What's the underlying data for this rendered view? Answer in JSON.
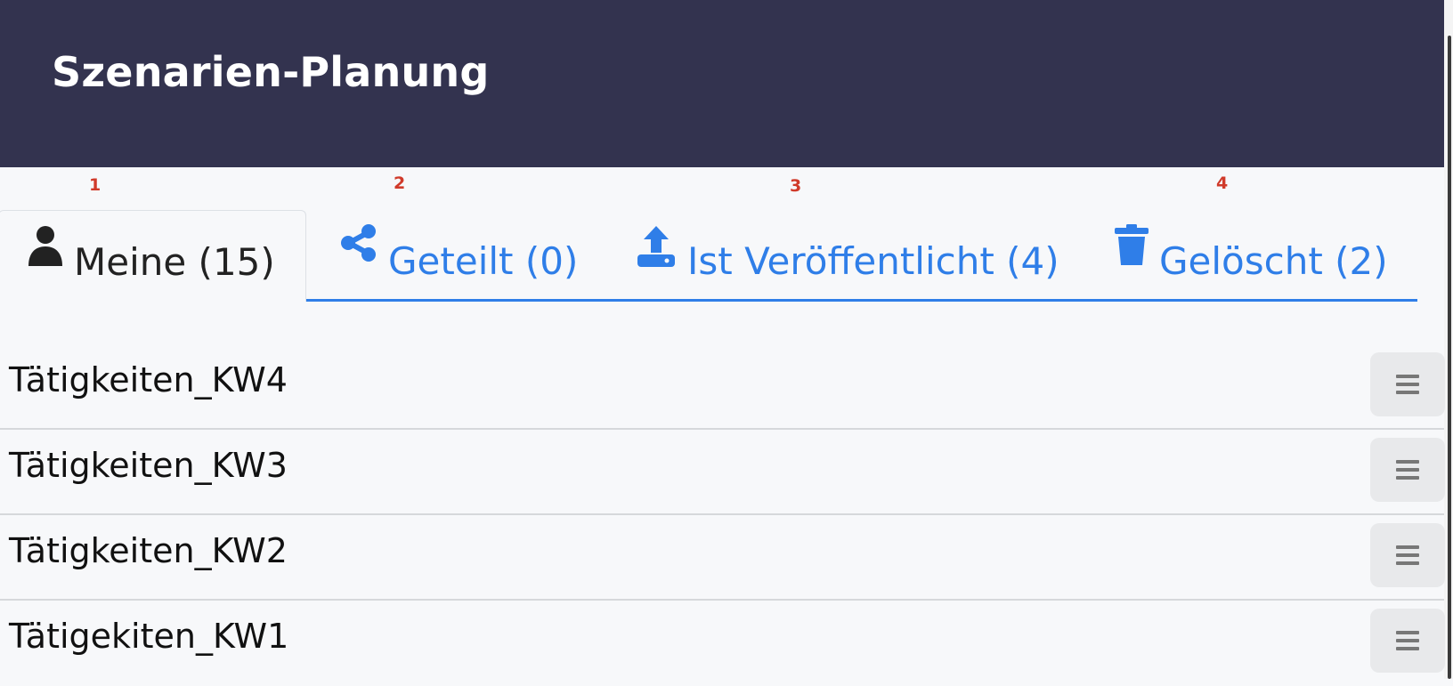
{
  "app": {
    "title": "Szenarien-Planung"
  },
  "markers": [
    "1",
    "2",
    "3",
    "4"
  ],
  "tabs": [
    {
      "label": "Meine (15)",
      "icon": "user-icon",
      "active": true
    },
    {
      "label": "Geteilt (0)",
      "icon": "share-icon",
      "active": false
    },
    {
      "label": "Ist Veröffentlicht (4)",
      "icon": "upload-icon",
      "active": false
    },
    {
      "label": "Gelöscht (2)",
      "icon": "trash-icon",
      "active": false
    }
  ],
  "scenarios": [
    {
      "name": "Tätigkeiten_KW4",
      "menu_icon": "hamburger-icon"
    },
    {
      "name": "Tätigkeiten_KW3",
      "menu_icon": "hamburger-icon"
    },
    {
      "name": "Tätigkeiten_KW2",
      "menu_icon": "hamburger-icon"
    },
    {
      "name": "Tätigekiten_KW1",
      "menu_icon": "hamburger-icon"
    }
  ],
  "colors": {
    "header_bg": "#33334f",
    "accent": "#2f7ee8",
    "marker": "#d03a2a",
    "page_bg": "#f7f8fa"
  }
}
